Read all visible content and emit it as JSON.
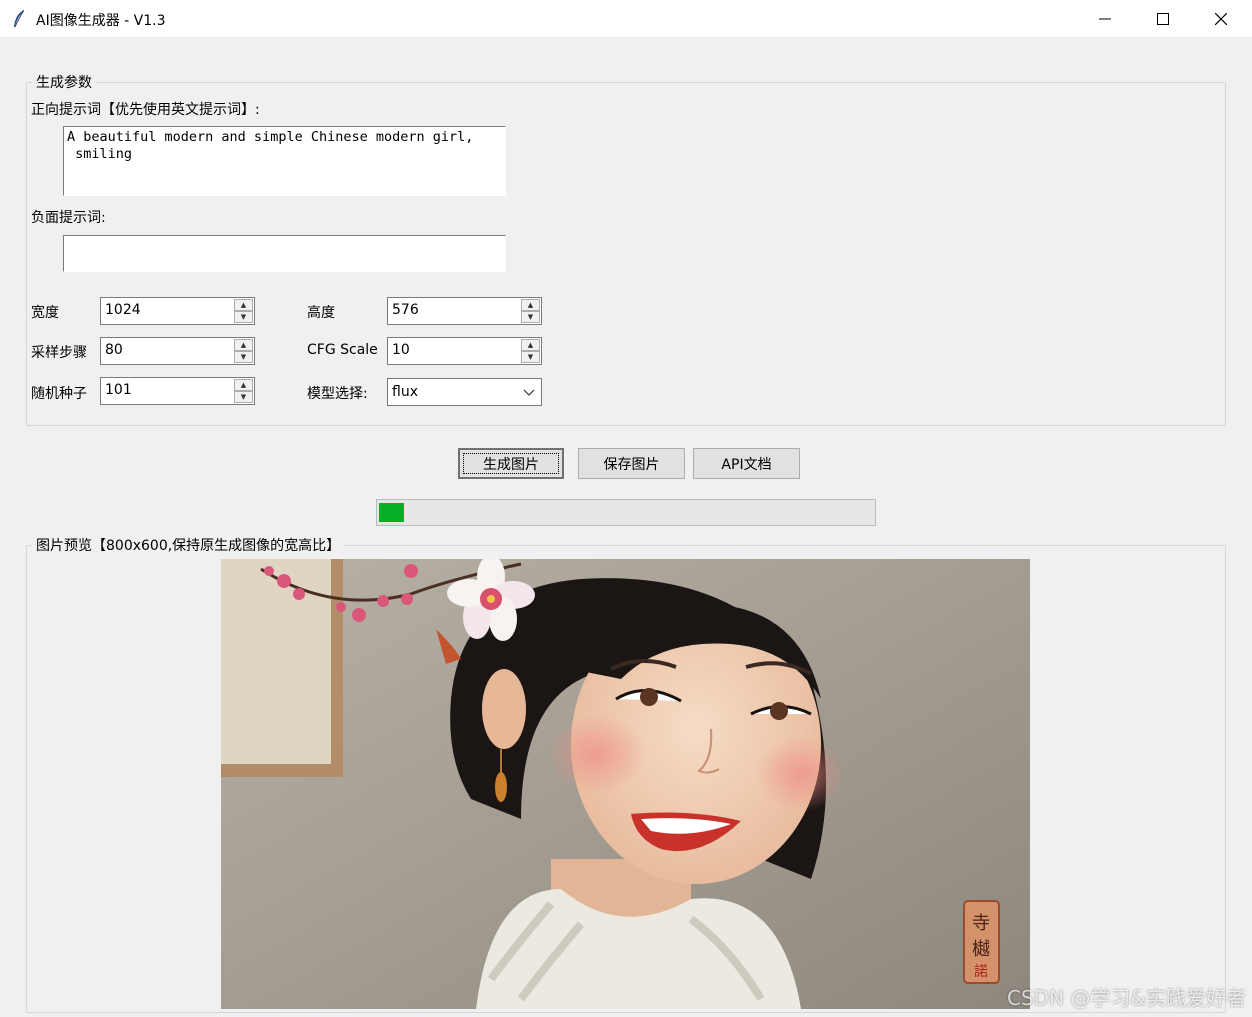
{
  "window": {
    "title": "AI图像生成器 - V1.3",
    "controls": {
      "minimize": "minimize-icon",
      "maximize": "maximize-icon",
      "close": "close-icon"
    }
  },
  "params": {
    "group_label": "生成参数",
    "positive_label": "正向提示词【优先使用英文提示词】:",
    "positive_value": "A beautiful modern and simple Chinese modern girl,\n smiling",
    "negative_label": "负面提示词:",
    "negative_value": "",
    "width_label": "宽度",
    "width_value": "1024",
    "height_label": "高度",
    "height_value": "576",
    "steps_label": "采样步骤",
    "steps_value": "80",
    "cfg_label": "CFG Scale",
    "cfg_value": "10",
    "seed_label": "随机种子",
    "seed_value": "101",
    "model_label": "模型选择:",
    "model_value": "flux"
  },
  "actions": {
    "generate": "生成图片",
    "save": "保存图片",
    "api_docs": "API文档"
  },
  "progress": {
    "value": 0.05,
    "color": "#06b025"
  },
  "preview": {
    "group_label": "图片预览【800x600,保持原生成图像的宽高比】",
    "seal_text": [
      "寺",
      "樾",
      "諾"
    ],
    "watermark": "CSDN @学习&实践爱好者"
  }
}
